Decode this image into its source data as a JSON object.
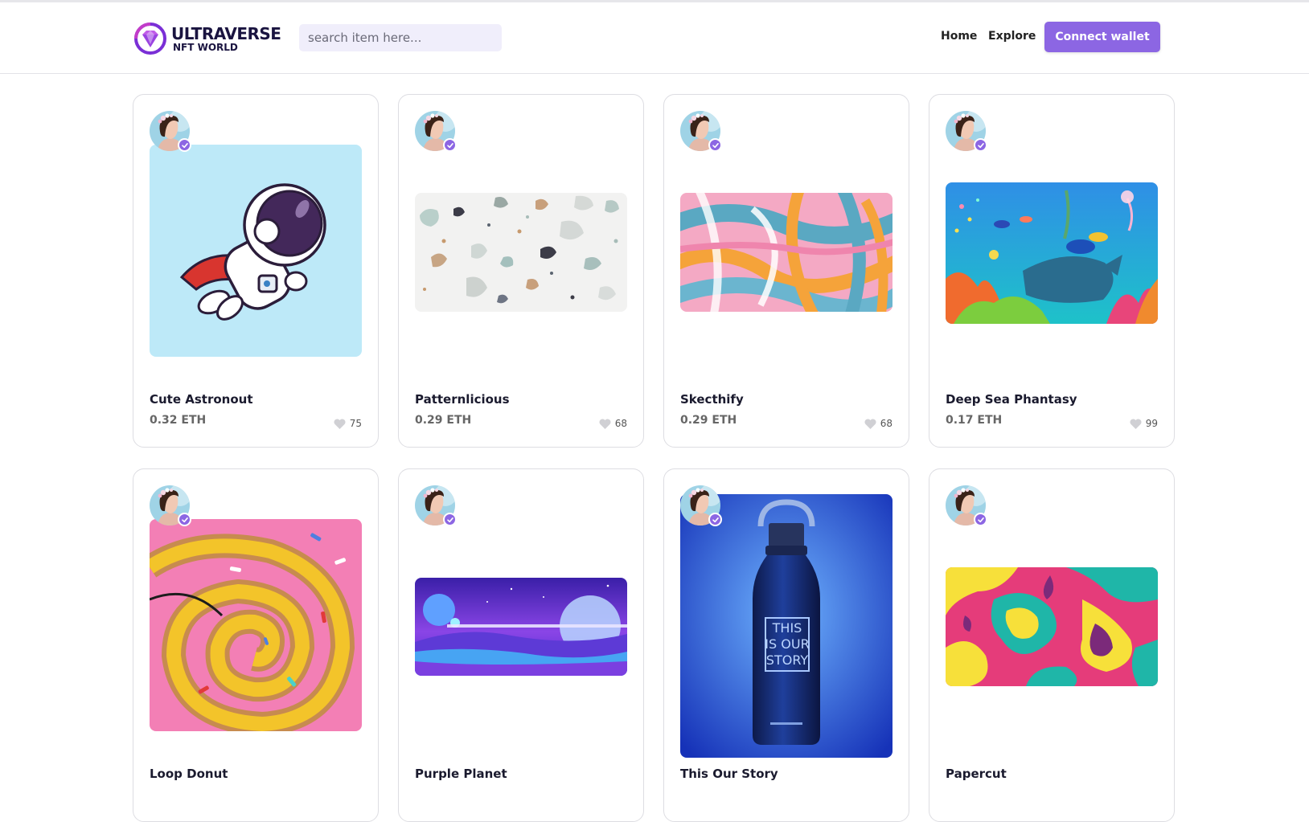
{
  "header": {
    "logo_title": "ULTRAVERSE",
    "logo_subtitle": "NFT WORLD",
    "search_placeholder": "search item here...",
    "nav": {
      "home": "Home",
      "explore": "Explore"
    },
    "connect_label": "Connect wallet"
  },
  "colors": {
    "accent": "#8c66e3",
    "search_bg": "#f0eefb"
  },
  "cards": [
    {
      "name": "Cute Astronout",
      "price": "0.32 ETH",
      "likes": "75",
      "art": "astronaut"
    },
    {
      "name": "Patternlicious",
      "price": "0.29 ETH",
      "likes": "68",
      "art": "terrazzo"
    },
    {
      "name": "Skecthify",
      "price": "0.29 ETH",
      "likes": "68",
      "art": "brush-strokes"
    },
    {
      "name": "Deep Sea Phantasy",
      "price": "0.17 ETH",
      "likes": "99",
      "art": "underwater"
    },
    {
      "name": "Loop Donut",
      "price": "",
      "likes": "",
      "art": "donut-spiral"
    },
    {
      "name": "Purple Planet",
      "price": "",
      "likes": "",
      "art": "purple-planet"
    },
    {
      "name": "This Our Story",
      "price": "",
      "likes": "",
      "art": "water-bottle",
      "art_caption": "THIS IS OUR STORY"
    },
    {
      "name": "Papercut",
      "price": "",
      "likes": "",
      "art": "papercut"
    }
  ]
}
